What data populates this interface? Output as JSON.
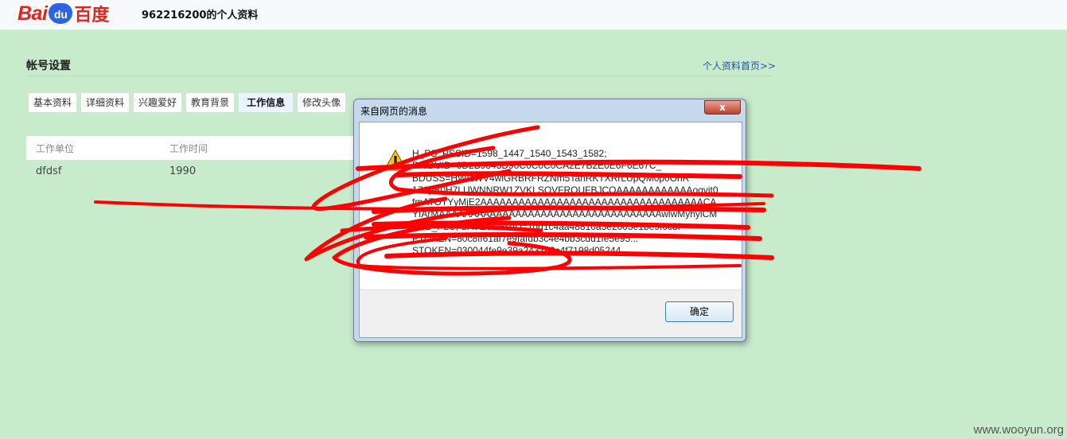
{
  "header": {
    "logo": {
      "bai": "Bai",
      "du": "du",
      "cn": "百度"
    },
    "page_title": "962216200的个人资料"
  },
  "settings": {
    "title": "帐号设置",
    "home_link": "个人资料首页>>",
    "tabs": [
      {
        "label": "基本资料",
        "active": false
      },
      {
        "label": "详细资料",
        "active": false
      },
      {
        "label": "兴趣爱好",
        "active": false
      },
      {
        "label": "教育背景",
        "active": false
      },
      {
        "label": "工作信息",
        "active": true
      },
      {
        "label": "修改头像",
        "active": false
      }
    ],
    "table": {
      "headers": [
        "工作单位",
        "工作时间"
      ],
      "rows": [
        [
          "dfdsf",
          "1990"
        ]
      ]
    }
  },
  "dialog": {
    "title": "来自网页的消息",
    "close_label": "x",
    "message_lines": [
      "H_PS_PSSID=1598_1447_1540_1543_1582;",
      "BAIDUID=6D2B9843D90C0C0C0CA2E7B2E0E6F6E67C_",
      "BDUSS=HWIzWV4wlGRBRFRZNm5TanRKTXRrLUpQM0p0OnR",
      "1Z0pB0H7LUWNNRW1ZVKLSQVFRQUFBJCQAAAAAAAAAAAAoqvit0",
      "fmATOTYyMjE2AAAAAAAAAAAAAAAAAAAAAAAAAAAAAAAAAAACA",
      "YIArMAAAAAAAAAAAAAAAAAAAAAAAAAAAAAAAAAAAwlwMyhylCM",
      "SUB_PLU; SAVEUSERID=1dd1c4aa48810a3e2005e1be9f0c8f",
      "PTOKEN=80c8ff61af7e9fafdb3c4e4bb3cdd1fe5e95...",
      "STOKEN=030044fe9e39a2437b2c4f7198d05244"
    ],
    "ok_label": "确定"
  },
  "watermark": "www.wooyun.org",
  "colors": {
    "page_bg": "#c8ebcc",
    "brand_red": "#e1251b",
    "brand_blue": "#2d64e0",
    "scribble_red": "#ff0000"
  }
}
